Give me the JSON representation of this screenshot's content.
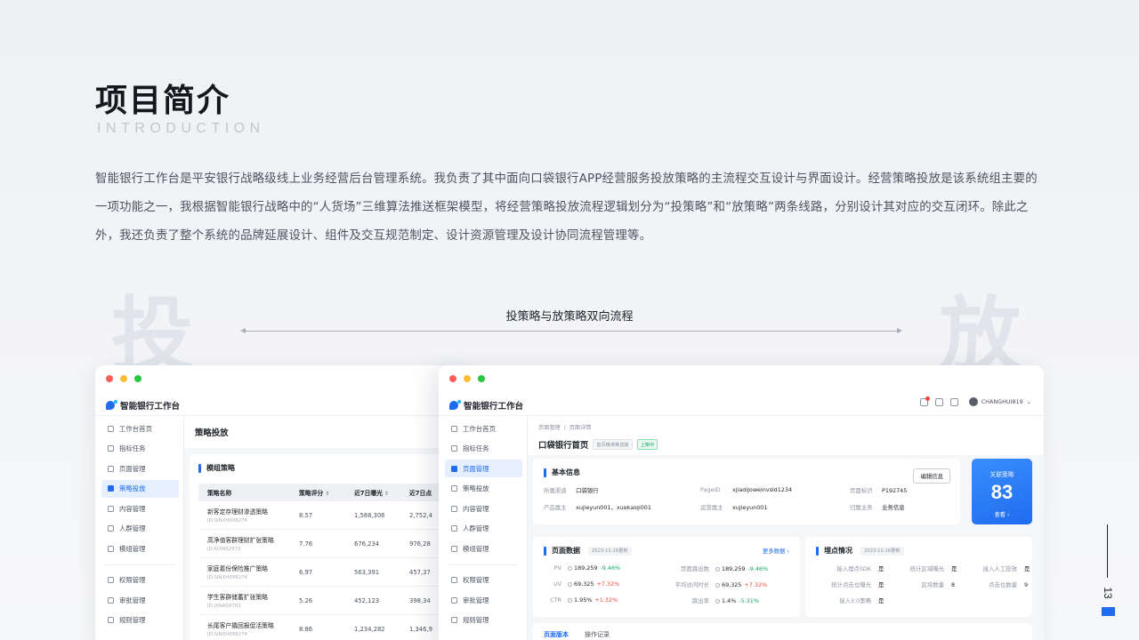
{
  "header": {
    "title": "项目简介",
    "subtitle": "INTRODUCTION",
    "description": "智能银行工作台是平安银行战略级线上业务经营后台管理系统。我负责了其中面向口袋银行APP经营服务投放策略的主流程交互设计与界面设计。经营策略投放是该系统组主要的一项功能之一，我根据智能银行战略中的“人货场”三维算法推送框架模型，将经营策略投放流程逻辑划分为“投策略”和“放策略”两条线路，分别设计其对应的交互闭环。除此之外，我还负责了整个系统的品牌延展设计、组件及交互规范制定、设计资源管理及设计协同流程管理等。"
  },
  "flow": {
    "caption": "投策略与放策略双向流程",
    "left_mark": "投",
    "right_mark": "放"
  },
  "page_number": "13",
  "app": {
    "name": "智能银行工作台",
    "nav": [
      {
        "label": "工作台首页"
      },
      {
        "label": "指标任务"
      },
      {
        "label": "页面管理"
      },
      {
        "label": "策略投放"
      },
      {
        "label": "内容管理"
      },
      {
        "label": "人群管理"
      },
      {
        "label": "模组管理"
      },
      {
        "label": "权限管理"
      },
      {
        "label": "审批管理"
      },
      {
        "label": "规则管理"
      }
    ]
  },
  "back_window": {
    "active_nav": "策略投放",
    "page_title": "策略投放",
    "section_title": "模组策略",
    "columns": [
      "策略名称",
      "策略评分",
      "近7日曝光",
      "近7日点"
    ],
    "rows": [
      {
        "name": "新客定存理财渗透策略",
        "id": "ID:SINXH098274",
        "score": "8.57",
        "exposure": "1,588,306",
        "clicks": "2,752,4"
      },
      {
        "name": "高净值客群理财扩张策略",
        "id": "ID:SIXNS2973",
        "score": "7.76",
        "exposure": "676,234",
        "clicks": "976,28"
      },
      {
        "name": "家庭着份保险推广策略",
        "id": "ID:SINXH098274",
        "score": "6.97",
        "exposure": "563,391",
        "clicks": "457,37"
      },
      {
        "name": "学生客群储蓄扩张策略",
        "id": "ID:JXNAS8763",
        "score": "5.26",
        "exposure": "452,123",
        "clicks": "398,34"
      },
      {
        "name": "长尾客户撬回报促活策略",
        "id": "ID:SINXH098274",
        "score": "8.86",
        "exposure": "1,234,282",
        "clicks": "1,346,9"
      }
    ]
  },
  "front_window": {
    "active_nav": "页面管理",
    "user": "CHANGHUI819",
    "notification_badge": "3",
    "breadcrumb": [
      "页面管理",
      "页面详情"
    ],
    "page_title": "口袋银行首页",
    "tags": [
      "首页精准推送版",
      "上架中"
    ],
    "basic": {
      "title": "基本信息",
      "edit_label": "编辑信息",
      "fields": [
        {
          "k": "所属渠道",
          "v": "口袋银行"
        },
        {
          "k": "PageID",
          "v": "xjiadijoweinvsld1234"
        },
        {
          "k": "页面标识",
          "v": "P192745"
        },
        {
          "k": "产品属主",
          "v": "xujieyun001、xuekaiqi001"
        },
        {
          "k": "运营属主",
          "v": "xujieyun001"
        },
        {
          "k": "归属业务",
          "v": "业务信息"
        }
      ]
    },
    "related": {
      "label": "关联策略",
      "count": "83",
      "link": "查看 ›"
    },
    "page_data": {
      "title": "页面数据",
      "date": "2023-11-16更新",
      "more": "更多数据 ›",
      "metrics": [
        {
          "k": "PV",
          "v": "189,259",
          "delta": "-9.46%",
          "trend": "up"
        },
        {
          "k": "页面跳出数",
          "v": "189,259",
          "delta": "-9.46%",
          "trend": "up"
        },
        {
          "k": "UV",
          "v": "69,325",
          "delta": "+7.32%",
          "trend": "down"
        },
        {
          "k": "平均访问时长",
          "v": "69,325",
          "delta": "+7.32%",
          "trend": "down"
        },
        {
          "k": "CTR",
          "v": "1.95%",
          "delta": "+1.32%",
          "trend": "down"
        },
        {
          "k": "跳出率",
          "v": "1.4%",
          "delta": "-5.31%",
          "trend": "up"
        }
      ]
    },
    "tracking": {
      "title": "埋点情况",
      "date": "2023-11-16更新",
      "items": [
        {
          "k": "接入埋点SDK",
          "v": "是"
        },
        {
          "k": "统计区域曝光",
          "v": "是"
        },
        {
          "k": "接入人工投放",
          "v": "是"
        },
        {
          "k": "统计点击位曝光",
          "v": "是"
        },
        {
          "k": "区块数量",
          "v": "8"
        },
        {
          "k": "点击位数量",
          "v": "9"
        },
        {
          "k": "接入3.0策略",
          "v": "是"
        }
      ]
    },
    "tabs": [
      "页面版本",
      "操作记录"
    ]
  },
  "colors": {
    "accent": "#1f6cf0",
    "positive": "#14a661",
    "negative": "#f0483e"
  }
}
